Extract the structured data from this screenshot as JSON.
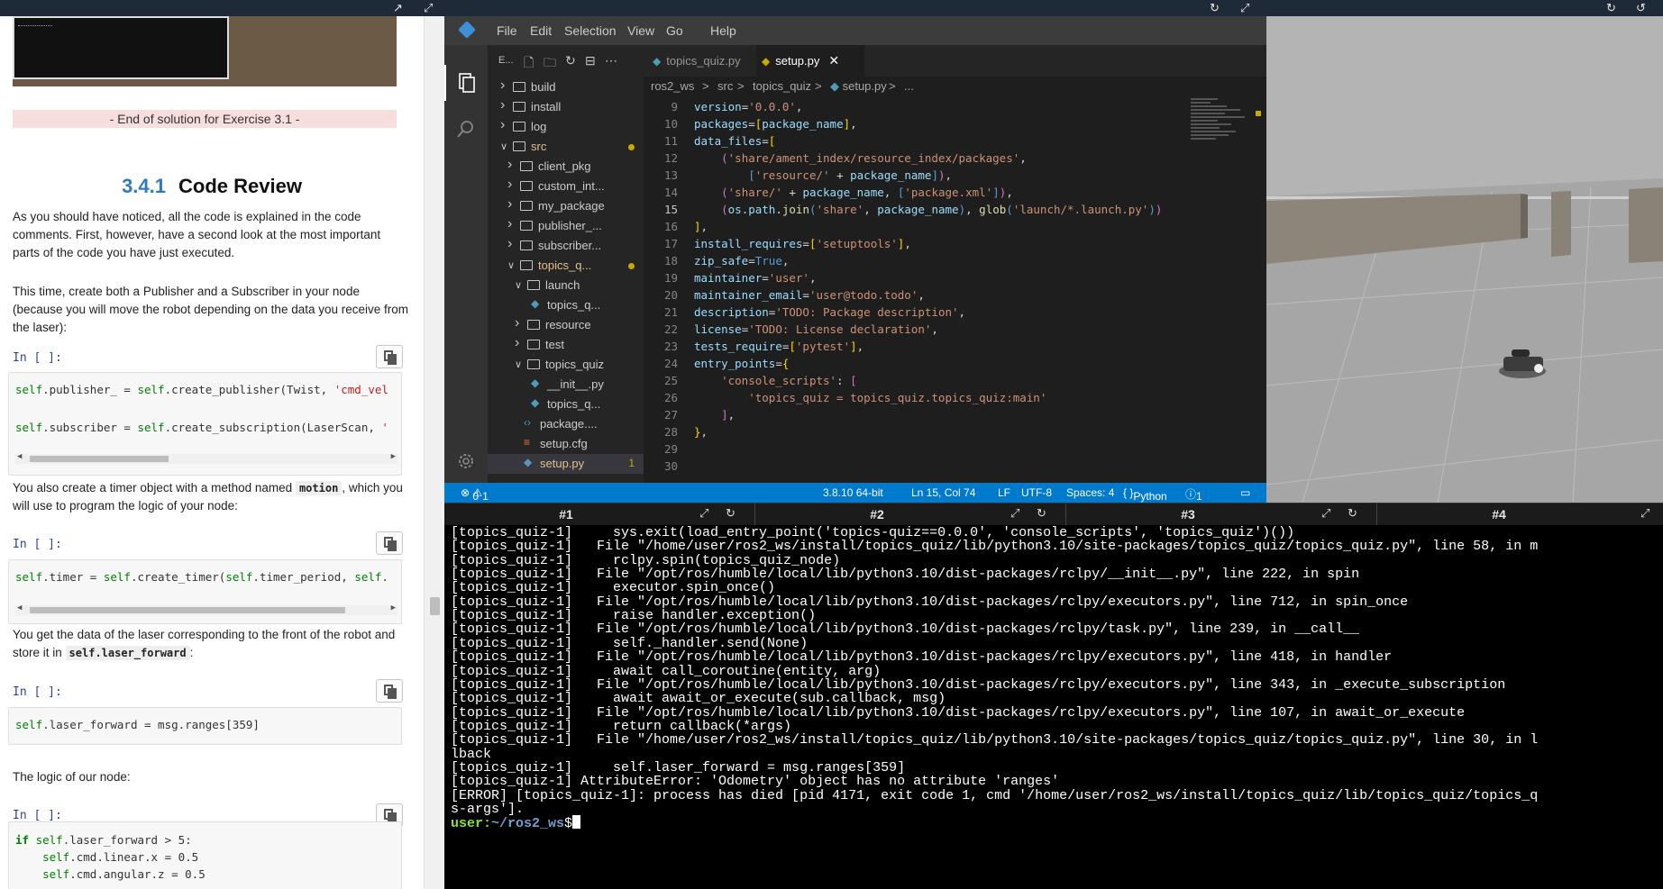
{
  "notebook": {
    "end_solution": "- End of solution for Exercise 3.1 -",
    "section_number": "3.4.1",
    "section_title": "Code Review",
    "para1": "As you should have noticed, all the code is explained in the code comments. First, however, have a second look at the most important parts of the code you have just executed.",
    "para2": "This time, create both a Publisher and a Subscriber in your node (because you will move the robot depending on the data you receive from the laser):",
    "para3_pre": "You also create a timer object with a method named",
    "para3_code": "motion",
    "para3_post": ", which you will use to program the logic of your node:",
    "para4_pre": "You get the data of the laser corresponding to the front of the robot and store it in",
    "para4_code": "self.laser_forward",
    "para4_post": ":",
    "para5": "The logic of our node:",
    "in_label": "In [ ]:",
    "cell1_line1": "self.publisher_ = self.create_publisher(Twist, 'cmd_vel",
    "cell1_line2": "self.subscriber = self.create_subscription(LaserScan, '",
    "cell2_line1": "self.timer = self.create_timer(self.timer_period, self.",
    "cell3_line1": "self.laser_forward = msg.ranges[359]",
    "cell4_line1": "if self.laser_forward > 5:",
    "cell4_line2": "    self.cmd.linear.x = 0.5",
    "cell4_line3": "    self.cmd.angular.z = 0.5"
  },
  "vscode": {
    "menu": [
      "File",
      "Edit",
      "Selection",
      "View",
      "Go",
      "Help"
    ],
    "explorer_title": "E...",
    "tabs": [
      {
        "label": "topics_quiz.py",
        "active": false
      },
      {
        "label": "setup.py",
        "active": true
      }
    ],
    "breadcrumb": [
      "ros2_ws",
      ">",
      "src",
      ">",
      "topics_quiz",
      ">",
      "setup.py",
      ">",
      "..."
    ],
    "tree": [
      {
        "label": "build",
        "indent": 0,
        "type": "folder",
        "open": false
      },
      {
        "label": "install",
        "indent": 0,
        "type": "folder",
        "open": false
      },
      {
        "label": "log",
        "indent": 0,
        "type": "folder",
        "open": false
      },
      {
        "label": "src",
        "indent": 0,
        "type": "folder",
        "open": true,
        "modified": true
      },
      {
        "label": "client_pkg",
        "indent": 1,
        "type": "folder",
        "open": false
      },
      {
        "label": "custom_int...",
        "indent": 1,
        "type": "folder",
        "open": false
      },
      {
        "label": "my_package",
        "indent": 1,
        "type": "folder",
        "open": false
      },
      {
        "label": "publisher_...",
        "indent": 1,
        "type": "folder",
        "open": false
      },
      {
        "label": "subscriber...",
        "indent": 1,
        "type": "folder",
        "open": false
      },
      {
        "label": "topics_q...",
        "indent": 1,
        "type": "folder",
        "open": true,
        "modified": true
      },
      {
        "label": "launch",
        "indent": 2,
        "type": "folder",
        "open": true
      },
      {
        "label": "topics_q...",
        "indent": 3,
        "type": "py"
      },
      {
        "label": "resource",
        "indent": 2,
        "type": "folder",
        "open": false
      },
      {
        "label": "test",
        "indent": 2,
        "type": "folder",
        "open": false
      },
      {
        "label": "topics_quiz",
        "indent": 2,
        "type": "folder",
        "open": true
      },
      {
        "label": "__init__.py",
        "indent": 3,
        "type": "py"
      },
      {
        "label": "topics_q...",
        "indent": 3,
        "type": "py"
      },
      {
        "label": "package....",
        "indent": 2,
        "type": "xml"
      },
      {
        "label": "setup.cfg",
        "indent": 2,
        "type": "cfg"
      },
      {
        "label": "setup.py",
        "indent": 2,
        "type": "py",
        "selected": true,
        "count": "1"
      }
    ],
    "line_numbers": [
      "9",
      "10",
      "11",
      "12",
      "13",
      "14",
      "15",
      "16",
      "17",
      "18",
      "19",
      "20",
      "21",
      "22",
      "23",
      "24",
      "25",
      "26",
      "27",
      "28",
      "29",
      "30"
    ],
    "current_line": "15",
    "status": {
      "problems": "0",
      "warnings": "1",
      "interpreter": "3.8.10 64-bit",
      "position": "Ln 15, Col 74",
      "eol": "LF",
      "encoding": "UTF-8",
      "spaces": "Spaces: 4",
      "language": "Python",
      "notifications": "1"
    }
  },
  "terminal": {
    "tabs": [
      "#1",
      "#2",
      "#3",
      "#4"
    ],
    "lines": [
      "[topics_quiz-1]     sys.exit(load_entry_point('topics-quiz==0.0.0', 'console_scripts', 'topics_quiz')())",
      "[topics_quiz-1]   File \"/home/user/ros2_ws/install/topics_quiz/lib/python3.10/site-packages/topics_quiz/topics_quiz.py\", line 58, in m",
      "[topics_quiz-1]     rclpy.spin(topics_quiz_node)",
      "[topics_quiz-1]   File \"/opt/ros/humble/local/lib/python3.10/dist-packages/rclpy/__init__.py\", line 222, in spin",
      "[topics_quiz-1]     executor.spin_once()",
      "[topics_quiz-1]   File \"/opt/ros/humble/local/lib/python3.10/dist-packages/rclpy/executors.py\", line 712, in spin_once",
      "[topics_quiz-1]     raise handler.exception()",
      "[topics_quiz-1]   File \"/opt/ros/humble/local/lib/python3.10/dist-packages/rclpy/task.py\", line 239, in __call__",
      "[topics_quiz-1]     self._handler.send(None)",
      "[topics_quiz-1]   File \"/opt/ros/humble/local/lib/python3.10/dist-packages/rclpy/executors.py\", line 418, in handler",
      "[topics_quiz-1]     await call_coroutine(entity, arg)",
      "[topics_quiz-1]   File \"/opt/ros/humble/local/lib/python3.10/dist-packages/rclpy/executors.py\", line 343, in _execute_subscription",
      "[topics_quiz-1]     await await_or_execute(sub.callback, msg)",
      "[topics_quiz-1]   File \"/opt/ros/humble/local/lib/python3.10/dist-packages/rclpy/executors.py\", line 107, in await_or_execute",
      "[topics_quiz-1]     return callback(*args)",
      "[topics_quiz-1]   File \"/home/user/ros2_ws/install/topics_quiz/lib/python3.10/site-packages/topics_quiz/topics_quiz.py\", line 30, in l",
      "lback",
      "[topics_quiz-1]     self.laser_forward = msg.ranges[359]",
      "[topics_quiz-1] AttributeError: 'Odometry' object has no attribute 'ranges'",
      "[ERROR] [topics_quiz-1]: process has died [pid 4171, exit code 1, cmd '/home/user/ros2_ws/install/topics_quiz/lib/topics_quiz/topics_q",
      "s-args']."
    ],
    "prompt_user": "user:",
    "prompt_path": "~/ros2_ws",
    "prompt_suffix": "$"
  }
}
